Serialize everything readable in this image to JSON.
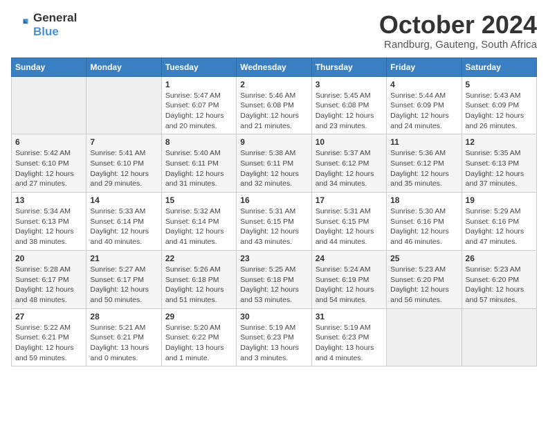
{
  "logo": {
    "line1": "General",
    "line2": "Blue"
  },
  "title": "October 2024",
  "subtitle": "Randburg, Gauteng, South Africa",
  "days_of_week": [
    "Sunday",
    "Monday",
    "Tuesday",
    "Wednesday",
    "Thursday",
    "Friday",
    "Saturday"
  ],
  "weeks": [
    [
      {
        "day": "",
        "info": ""
      },
      {
        "day": "",
        "info": ""
      },
      {
        "day": "1",
        "info": "Sunrise: 5:47 AM\nSunset: 6:07 PM\nDaylight: 12 hours and 20 minutes."
      },
      {
        "day": "2",
        "info": "Sunrise: 5:46 AM\nSunset: 6:08 PM\nDaylight: 12 hours and 21 minutes."
      },
      {
        "day": "3",
        "info": "Sunrise: 5:45 AM\nSunset: 6:08 PM\nDaylight: 12 hours and 23 minutes."
      },
      {
        "day": "4",
        "info": "Sunrise: 5:44 AM\nSunset: 6:09 PM\nDaylight: 12 hours and 24 minutes."
      },
      {
        "day": "5",
        "info": "Sunrise: 5:43 AM\nSunset: 6:09 PM\nDaylight: 12 hours and 26 minutes."
      }
    ],
    [
      {
        "day": "6",
        "info": "Sunrise: 5:42 AM\nSunset: 6:10 PM\nDaylight: 12 hours and 27 minutes."
      },
      {
        "day": "7",
        "info": "Sunrise: 5:41 AM\nSunset: 6:10 PM\nDaylight: 12 hours and 29 minutes."
      },
      {
        "day": "8",
        "info": "Sunrise: 5:40 AM\nSunset: 6:11 PM\nDaylight: 12 hours and 31 minutes."
      },
      {
        "day": "9",
        "info": "Sunrise: 5:38 AM\nSunset: 6:11 PM\nDaylight: 12 hours and 32 minutes."
      },
      {
        "day": "10",
        "info": "Sunrise: 5:37 AM\nSunset: 6:12 PM\nDaylight: 12 hours and 34 minutes."
      },
      {
        "day": "11",
        "info": "Sunrise: 5:36 AM\nSunset: 6:12 PM\nDaylight: 12 hours and 35 minutes."
      },
      {
        "day": "12",
        "info": "Sunrise: 5:35 AM\nSunset: 6:13 PM\nDaylight: 12 hours and 37 minutes."
      }
    ],
    [
      {
        "day": "13",
        "info": "Sunrise: 5:34 AM\nSunset: 6:13 PM\nDaylight: 12 hours and 38 minutes."
      },
      {
        "day": "14",
        "info": "Sunrise: 5:33 AM\nSunset: 6:14 PM\nDaylight: 12 hours and 40 minutes."
      },
      {
        "day": "15",
        "info": "Sunrise: 5:32 AM\nSunset: 6:14 PM\nDaylight: 12 hours and 41 minutes."
      },
      {
        "day": "16",
        "info": "Sunrise: 5:31 AM\nSunset: 6:15 PM\nDaylight: 12 hours and 43 minutes."
      },
      {
        "day": "17",
        "info": "Sunrise: 5:31 AM\nSunset: 6:15 PM\nDaylight: 12 hours and 44 minutes."
      },
      {
        "day": "18",
        "info": "Sunrise: 5:30 AM\nSunset: 6:16 PM\nDaylight: 12 hours and 46 minutes."
      },
      {
        "day": "19",
        "info": "Sunrise: 5:29 AM\nSunset: 6:16 PM\nDaylight: 12 hours and 47 minutes."
      }
    ],
    [
      {
        "day": "20",
        "info": "Sunrise: 5:28 AM\nSunset: 6:17 PM\nDaylight: 12 hours and 48 minutes."
      },
      {
        "day": "21",
        "info": "Sunrise: 5:27 AM\nSunset: 6:17 PM\nDaylight: 12 hours and 50 minutes."
      },
      {
        "day": "22",
        "info": "Sunrise: 5:26 AM\nSunset: 6:18 PM\nDaylight: 12 hours and 51 minutes."
      },
      {
        "day": "23",
        "info": "Sunrise: 5:25 AM\nSunset: 6:18 PM\nDaylight: 12 hours and 53 minutes."
      },
      {
        "day": "24",
        "info": "Sunrise: 5:24 AM\nSunset: 6:19 PM\nDaylight: 12 hours and 54 minutes."
      },
      {
        "day": "25",
        "info": "Sunrise: 5:23 AM\nSunset: 6:20 PM\nDaylight: 12 hours and 56 minutes."
      },
      {
        "day": "26",
        "info": "Sunrise: 5:23 AM\nSunset: 6:20 PM\nDaylight: 12 hours and 57 minutes."
      }
    ],
    [
      {
        "day": "27",
        "info": "Sunrise: 5:22 AM\nSunset: 6:21 PM\nDaylight: 12 hours and 59 minutes."
      },
      {
        "day": "28",
        "info": "Sunrise: 5:21 AM\nSunset: 6:21 PM\nDaylight: 13 hours and 0 minutes."
      },
      {
        "day": "29",
        "info": "Sunrise: 5:20 AM\nSunset: 6:22 PM\nDaylight: 13 hours and 1 minute."
      },
      {
        "day": "30",
        "info": "Sunrise: 5:19 AM\nSunset: 6:23 PM\nDaylight: 13 hours and 3 minutes."
      },
      {
        "day": "31",
        "info": "Sunrise: 5:19 AM\nSunset: 6:23 PM\nDaylight: 13 hours and 4 minutes."
      },
      {
        "day": "",
        "info": ""
      },
      {
        "day": "",
        "info": ""
      }
    ]
  ]
}
